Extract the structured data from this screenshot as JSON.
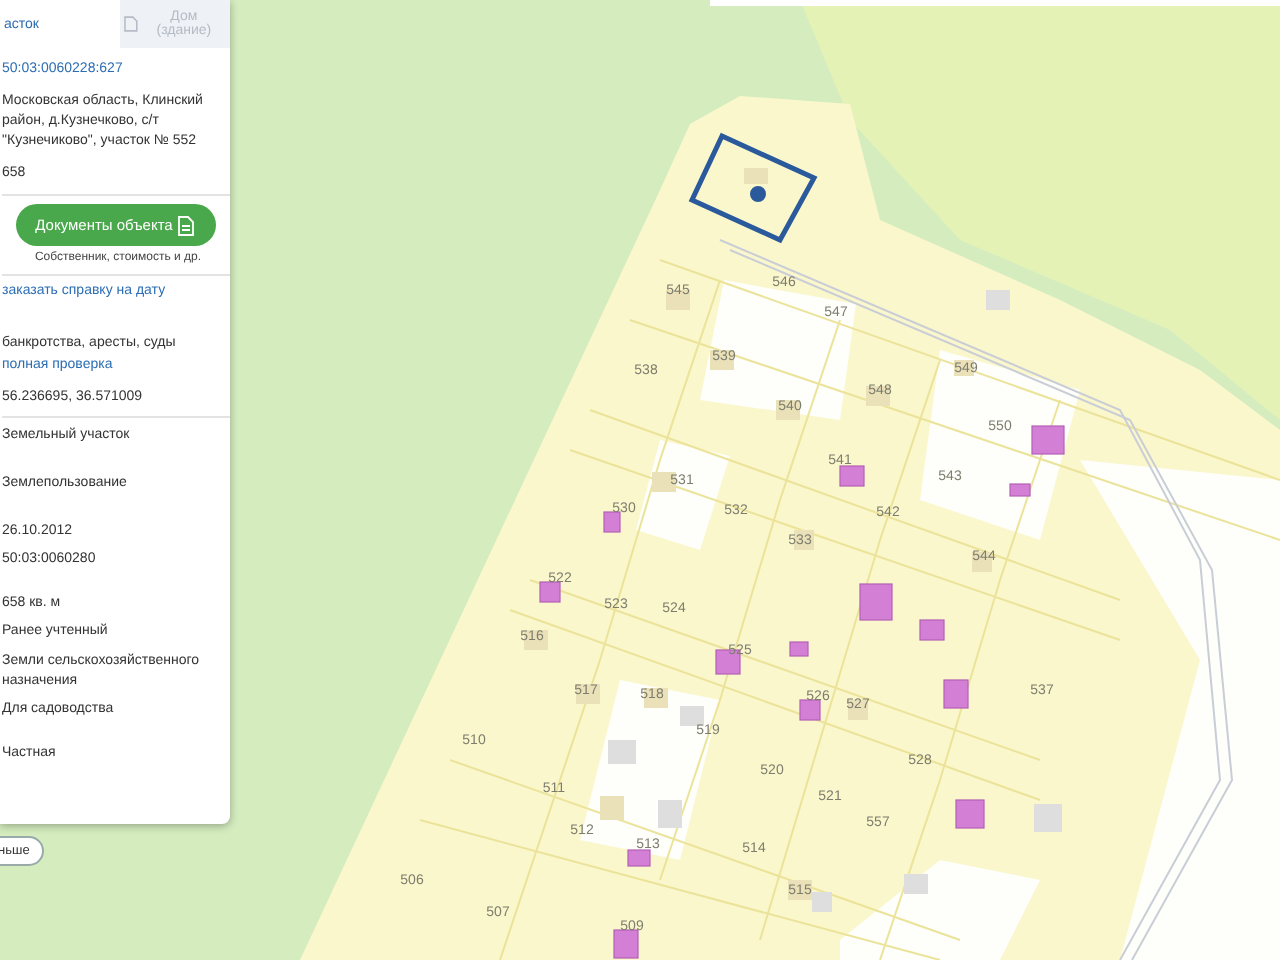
{
  "panel": {
    "tabs": [
      {
        "label": "асток",
        "selected": true,
        "kind": "plain"
      },
      {
        "label": "Дом (здание)",
        "selected": false,
        "kind": "house"
      }
    ],
    "items": [
      {
        "kind": "link",
        "text": "50:03:0060228:627"
      },
      {
        "kind": "text",
        "text": "Московская область, Клинский район, д.Кузнечково, с/т \"Кузнечиково\", участок № 552"
      },
      {
        "kind": "text",
        "text": "658"
      },
      {
        "kind": "divider"
      },
      {
        "kind": "button",
        "text": "Документы объекта",
        "caption": "Собственник, стоимость и др."
      },
      {
        "kind": "divider"
      },
      {
        "kind": "link",
        "text": "заказать справку на дату"
      },
      {
        "kind": "text",
        "text": "банкротства, аресты, суды"
      },
      {
        "kind": "link",
        "text": "полная проверка"
      },
      {
        "kind": "text",
        "text": "56.236695, 36.571009"
      },
      {
        "kind": "divider"
      },
      {
        "kind": "text",
        "text": "Земельный участок"
      },
      {
        "kind": "text",
        "text": "Землепользование"
      },
      {
        "kind": "text",
        "text": "26.10.2012"
      },
      {
        "kind": "text",
        "text": "50:03:0060280"
      },
      {
        "kind": "text",
        "text": "658 кв. м"
      },
      {
        "kind": "text",
        "text": "Ранее учтенный"
      },
      {
        "kind": "text",
        "text": "Земли сельскохозяйственного назначения"
      },
      {
        "kind": "text",
        "text": "Для садоводства"
      },
      {
        "kind": "text",
        "text": "Частная"
      }
    ]
  },
  "toggle": {
    "label": "ньше"
  },
  "map": {
    "plots": [
      "545",
      "546",
      "547",
      "538",
      "539",
      "549",
      "548",
      "540",
      "550",
      "541",
      "531",
      "543",
      "530",
      "532",
      "542",
      "533",
      "544",
      "522",
      "523",
      "524",
      "516",
      "525",
      "517",
      "518",
      "526",
      "527",
      "537",
      "510",
      "519",
      "520",
      "528",
      "511",
      "521",
      "512",
      "557",
      "513",
      "514",
      "506",
      "515",
      "507",
      "509"
    ]
  }
}
